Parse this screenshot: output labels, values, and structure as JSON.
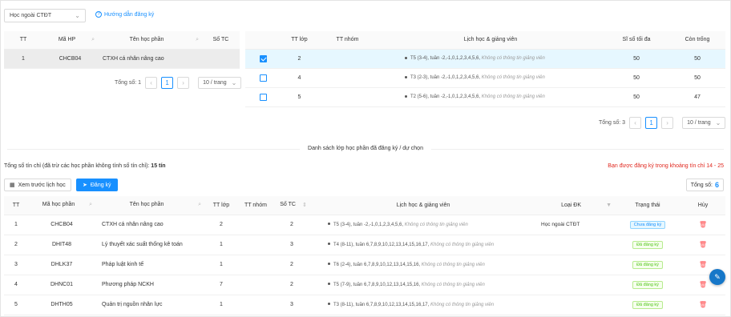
{
  "top": {
    "select": "Học ngoài CTĐT",
    "guide": "Hướng dẫn đăng ký"
  },
  "left_table": {
    "headers": [
      "TT",
      "Mã HP",
      "Tên học phần",
      "Số TC"
    ],
    "rows": [
      {
        "tt": "1",
        "ma": "CHCB04",
        "ten": "CTXH cá nhân nâng cao",
        "tc": ""
      }
    ],
    "pager": {
      "total": "Tổng số: 1",
      "page": "1",
      "size": "10 / trang"
    }
  },
  "right_table": {
    "headers": [
      "TT lớp",
      "TT nhóm",
      "Lịch học & giảng viên",
      "Sĩ số tối đa",
      "Còn trống"
    ],
    "rows": [
      {
        "tt": "2",
        "nhom": "",
        "lich": "T5 (3-4), tuần -2,-1,0,1,2,3,4,5,6, ",
        "gv": "Không có thông tin giảng viên",
        "siso": "50",
        "con": "50",
        "checked": true
      },
      {
        "tt": "4",
        "nhom": "",
        "lich": "T3 (2-3), tuần -2,-1,0,1,2,3,4,5,6, ",
        "gv": "Không có thông tin giảng viên",
        "siso": "50",
        "con": "50",
        "checked": false
      },
      {
        "tt": "5",
        "nhom": "",
        "lich": "T2 (5-6), tuần -2,-1,0,1,2,3,4,5,6, ",
        "gv": "Không có thông tin giảng viên",
        "siso": "50",
        "con": "47",
        "checked": false
      }
    ],
    "pager": {
      "total": "Tổng số: 3",
      "page": "1",
      "size": "10 / trang"
    }
  },
  "divider": "Danh sách lớp học phần đã đăng ký / dự chọn",
  "summary": {
    "label": "Tổng số tín chỉ (đã trừ các học phần không tính số tín chỉ): ",
    "value": "15 tín"
  },
  "warning": "Bạn được đăng ký trong khoảng tín chỉ 14 - 25",
  "actions": {
    "preview": "Xem trước lịch học",
    "register": "Đăng ký",
    "count_label": "Tổng số:",
    "count": "6"
  },
  "bottom_table": {
    "headers": [
      "TT",
      "Mã học phần",
      "Tên học phần",
      "TT lớp",
      "TT nhóm",
      "Số TC",
      "Lịch học & giảng viên",
      "Loại ĐK",
      "Trạng thái",
      "Hủy"
    ],
    "rows": [
      {
        "tt": "1",
        "ma": "CHCB04",
        "ten": "CTXH cá nhân nâng cao",
        "lop": "2",
        "nhom": "",
        "tc": "2",
        "lich": "T5 (3-4), tuần -2,-1,0,1,2,3,4,5,6, ",
        "gv": "Không có thông tin giảng viên",
        "loai": "Học ngoài CTĐT",
        "status": "Chưa đăng ký",
        "status_color": "blue"
      },
      {
        "tt": "2",
        "ma": "DHIT48",
        "ten": "Lý thuyết xác suất thống kê toán",
        "lop": "1",
        "nhom": "",
        "tc": "3",
        "lich": "T4 (8-11), tuần 6,7,8,9,10,12,13,14,15,16,17, ",
        "gv": "Không có thông tin giảng viên",
        "loai": "",
        "status": "Đã đăng ký",
        "status_color": "green"
      },
      {
        "tt": "3",
        "ma": "DHLK37",
        "ten": "Pháp luật kinh tế",
        "lop": "1",
        "nhom": "",
        "tc": "2",
        "lich": "T6 (2-4), tuần 6,7,8,9,10,12,13,14,15,16, ",
        "gv": "Không có thông tin giảng viên",
        "loai": "",
        "status": "Đã đăng ký",
        "status_color": "green"
      },
      {
        "tt": "4",
        "ma": "DHNC01",
        "ten": "Phương pháp NCKH",
        "lop": "7",
        "nhom": "",
        "tc": "2",
        "lich": "T5 (7-9), tuần 6,7,8,9,10,12,13,14,15,16, ",
        "gv": "Không có thông tin giảng viên",
        "loai": "",
        "status": "Đã đăng ký",
        "status_color": "green"
      },
      {
        "tt": "5",
        "ma": "DHTH05",
        "ten": "Quản trị nguồn nhân lực",
        "lop": "1",
        "nhom": "",
        "tc": "3",
        "lich": "T3 (8-11), tuần 6,7,8,9,10,12,13,14,15,16,17, ",
        "gv": "Không có thông tin giảng viên",
        "loai": "",
        "status": "Đã đăng ký",
        "status_color": "green"
      }
    ]
  },
  "icons": {
    "search": "search-icon",
    "trash": "trash-icon",
    "calendar": "calendar-icon",
    "send": "send-icon",
    "edit": "edit-icon"
  }
}
